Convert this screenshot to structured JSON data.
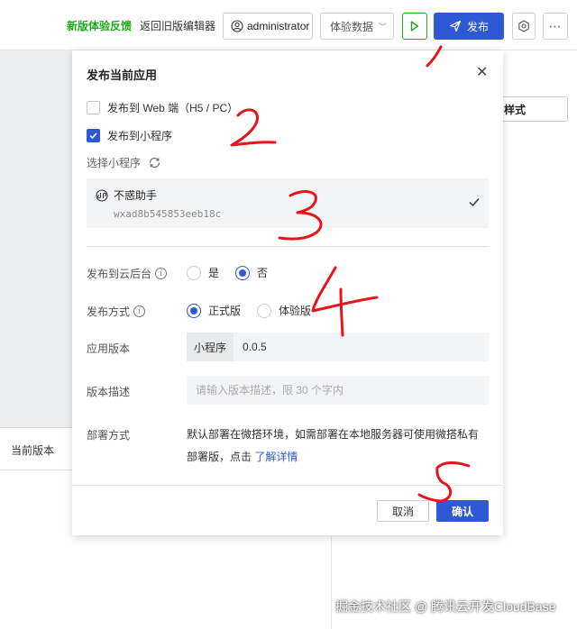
{
  "topbar": {
    "feedback": "新版体验反馈",
    "old_editor": "返回旧版编辑器",
    "user": "administrator",
    "experience": "体验数据",
    "publish": "发布"
  },
  "background": {
    "style_button": "样式",
    "current_version": "当前版本"
  },
  "dialog": {
    "title": "发布当前应用",
    "publish_web": "发布到 Web 端（H5 / PC）",
    "publish_web_checked": false,
    "publish_mp": "发布到小程序",
    "publish_mp_checked": true,
    "select_mp_label": "选择小程序",
    "mini_program": {
      "name": "不惑助手",
      "appid": "wxad8b545853eeb18c",
      "selected": true
    },
    "cloud_console": {
      "label": "发布到云后台",
      "options": [
        "是",
        "否"
      ],
      "selected": "否"
    },
    "publish_mode": {
      "label": "发布方式",
      "options": [
        "正式版",
        "体验版"
      ],
      "selected": "正式版"
    },
    "app_version": {
      "label": "应用版本",
      "prefix": "小程序",
      "value": "0.0.5"
    },
    "version_desc": {
      "label": "版本描述",
      "placeholder": "请输入版本描述，限 30 个字内"
    },
    "deploy": {
      "label": "部署方式",
      "text": "默认部署在微搭环境，如需部署在本地服务器可使用微搭私有部署版，点击 ",
      "link": "了解详情"
    },
    "cancel": "取消",
    "confirm": "确认"
  },
  "watermark": "掘金技术社区 @ 腾讯云开发CloudBase",
  "colors": {
    "primary": "#2e58d6",
    "feedback_green": "#1aad19",
    "annotation_red": "#e8141b"
  },
  "annotations": [
    "1",
    "2",
    "3",
    "4",
    "5"
  ]
}
